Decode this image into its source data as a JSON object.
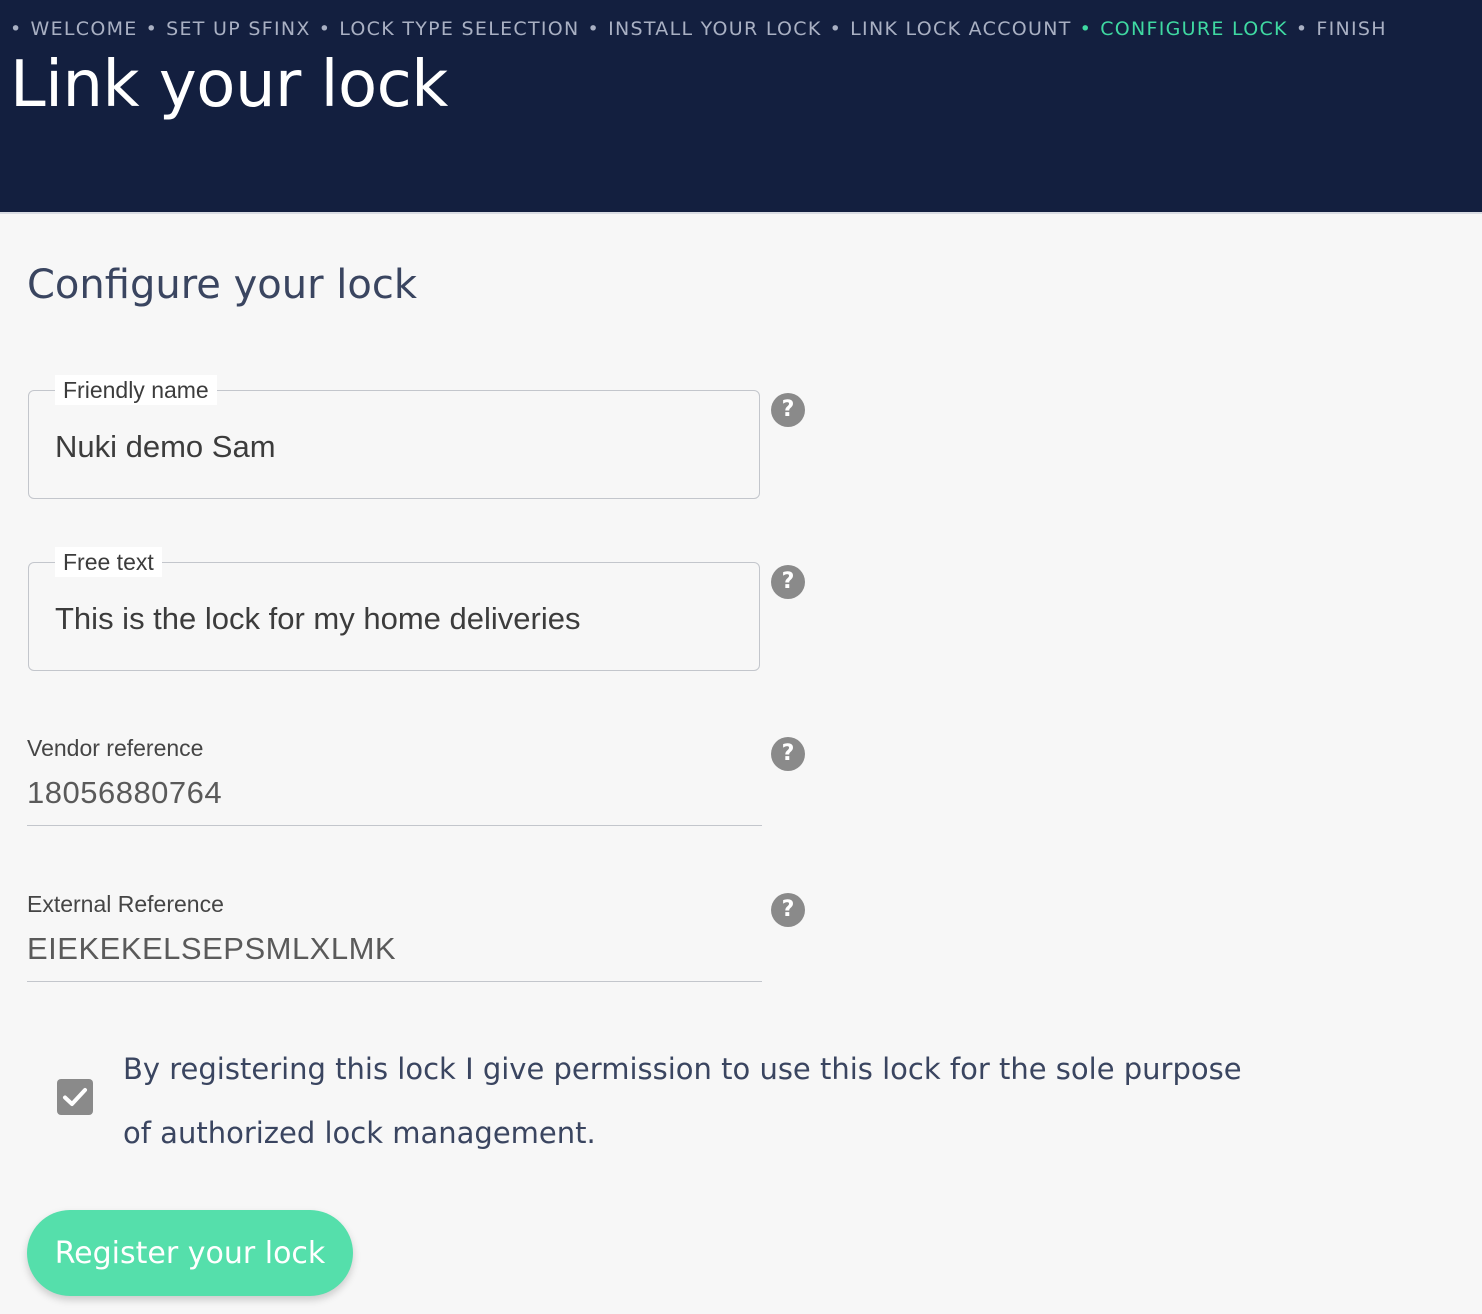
{
  "header": {
    "steps": [
      {
        "label": "WELCOME",
        "active": false
      },
      {
        "label": "SET UP SFINX",
        "active": false
      },
      {
        "label": "LOCK TYPE SELECTION",
        "active": false
      },
      {
        "label": "INSTALL YOUR LOCK",
        "active": false
      },
      {
        "label": "LINK LOCK ACCOUNT",
        "active": false
      },
      {
        "label": "CONFIGURE LOCK",
        "active": true
      },
      {
        "label": "FINISH",
        "active": false
      }
    ],
    "bullet": "•",
    "title": "Link your lock"
  },
  "main": {
    "section_title": "Configure your lock",
    "friendly_name": {
      "label": "Friendly name",
      "value": "Nuki demo Sam"
    },
    "free_text": {
      "label": "Free text",
      "value": "This is the lock for my home deliveries"
    },
    "vendor_reference": {
      "label": "Vendor reference",
      "value": "18056880764"
    },
    "external_reference": {
      "label": "External Reference",
      "value": "EIEKEKELSEPSMLXLMK"
    },
    "help_glyph": "?",
    "consent": {
      "checked": true,
      "text": "By registering this lock I give permission to use this lock for the sole purpose of authorized lock management."
    },
    "register_button": "Register your lock"
  },
  "colors": {
    "header_bg": "#131f3f",
    "active_step": "#3fd9a2",
    "inactive_step": "#a9b0c3",
    "button_bg": "#55dfab",
    "page_bg": "#f7f7f7"
  },
  "icons": {
    "help": "question-circle-icon",
    "checkbox": "checkmark-icon"
  }
}
